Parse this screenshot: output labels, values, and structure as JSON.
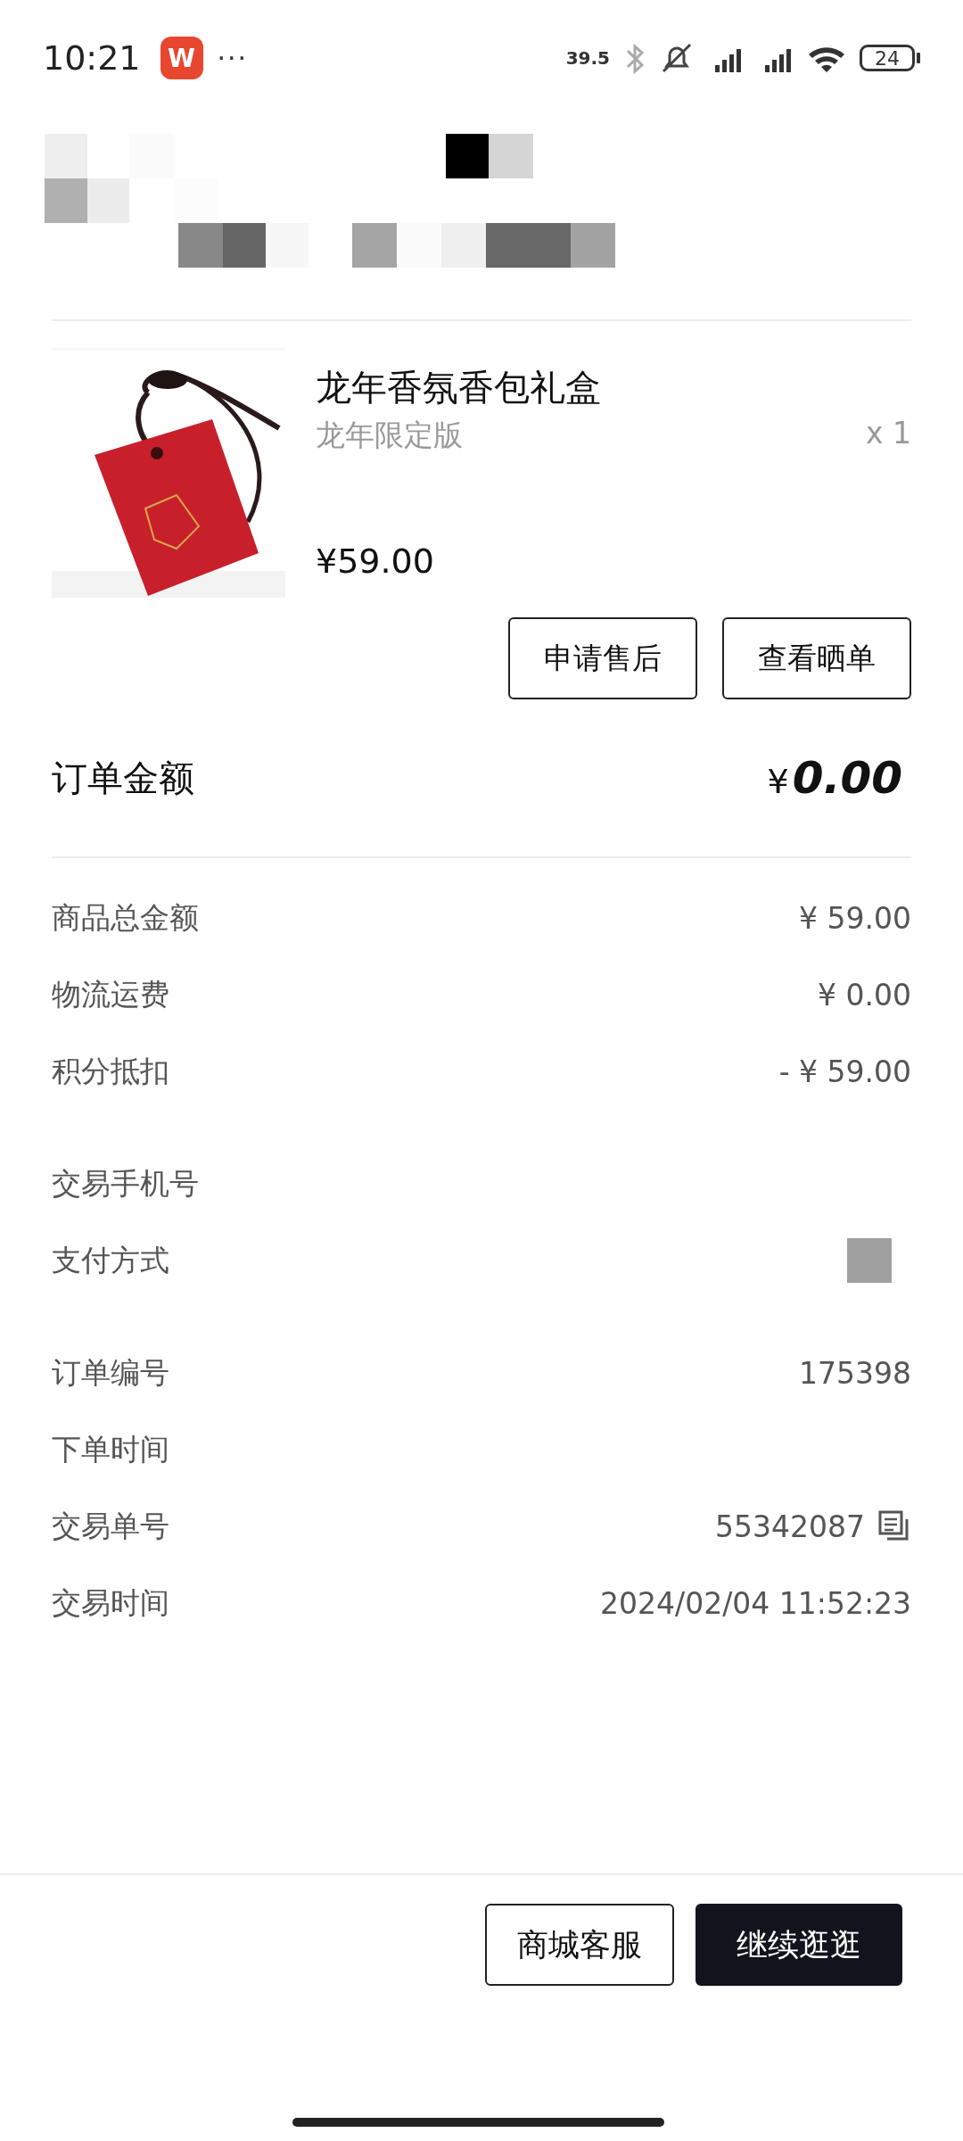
{
  "status_bar": {
    "time": "10:21",
    "app_badge": "W",
    "more": "···",
    "network_speed": "39.5",
    "battery": "24"
  },
  "product": {
    "title": "龙年香氛香包礼盒",
    "variant": "龙年限定版",
    "quantity": "x 1",
    "price": "¥59.00"
  },
  "actions": [
    {
      "label": "申请售后"
    },
    {
      "label": "查看晒单"
    }
  ],
  "order_total": {
    "label": "订单金额",
    "currency": "¥",
    "amount": "0.00"
  },
  "detail_groups": [
    [
      {
        "label": "商品总金额",
        "value": "¥ 59.00"
      },
      {
        "label": "物流运费",
        "value": "¥ 0.00"
      },
      {
        "label": "积分抵扣",
        "value": "- ¥ 59.00"
      }
    ],
    [
      {
        "label": "交易手机号"
      },
      {
        "label": "支付方式"
      }
    ],
    [
      {
        "label": "订单编号",
        "value": "175398"
      },
      {
        "label": "下单时间"
      },
      {
        "label": "交易单号",
        "value": "55342087",
        "copy": true
      },
      {
        "label": "交易时间",
        "value": "2024/02/04 11:52:23"
      }
    ]
  ],
  "bottom_buttons": [
    {
      "label": "商城客服",
      "primary": false
    },
    {
      "label": "继续逛逛",
      "primary": true
    }
  ]
}
